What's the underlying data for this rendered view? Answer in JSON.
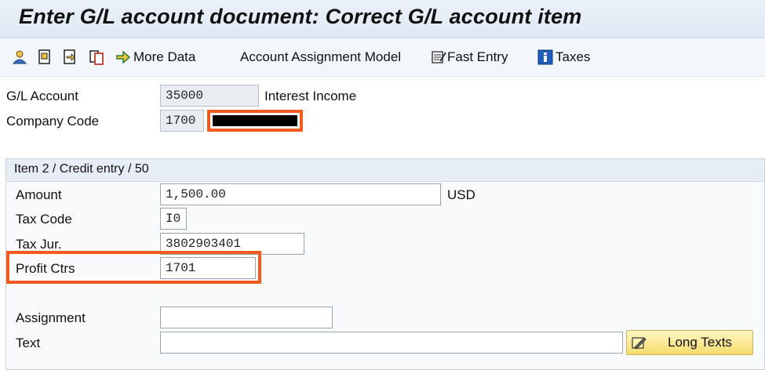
{
  "window": {
    "title": "Enter G/L account document: Correct G/L account item"
  },
  "toolbar": {
    "more_data_label": "More Data",
    "account_assignment_label": "Account Assignment Model",
    "fast_entry_label": "Fast Entry",
    "taxes_label": "Taxes"
  },
  "header": {
    "gl_account": {
      "label": "G/L Account",
      "value": "35000",
      "description": "Interest Income"
    },
    "company_code": {
      "label": "Company Code",
      "value": "1700"
    }
  },
  "item": {
    "group_title": "Item 2 / Credit entry / 50",
    "amount": {
      "label": "Amount",
      "value": "1,500.00",
      "currency": "USD"
    },
    "tax_code": {
      "label": "Tax Code",
      "value": "I0"
    },
    "tax_jur": {
      "label": "Tax Jur.",
      "value": "3802903401"
    },
    "profit_ctr": {
      "label": "Profit Ctrs",
      "value": "1701"
    },
    "assignment": {
      "label": "Assignment",
      "value": ""
    },
    "text": {
      "label": "Text",
      "value": ""
    },
    "long_texts_label": "Long Texts"
  },
  "colors": {
    "highlight": "#f25a1e",
    "readonly_bg": "#e9edf2",
    "button_bg": "#f6dc6d"
  },
  "icons": [
    "user-pin-icon",
    "document-edit-icon",
    "document-forward-icon",
    "document-copy-icon",
    "arrow-more-icon",
    "fast-entry-icon",
    "info-icon",
    "pencil-note-icon"
  ]
}
